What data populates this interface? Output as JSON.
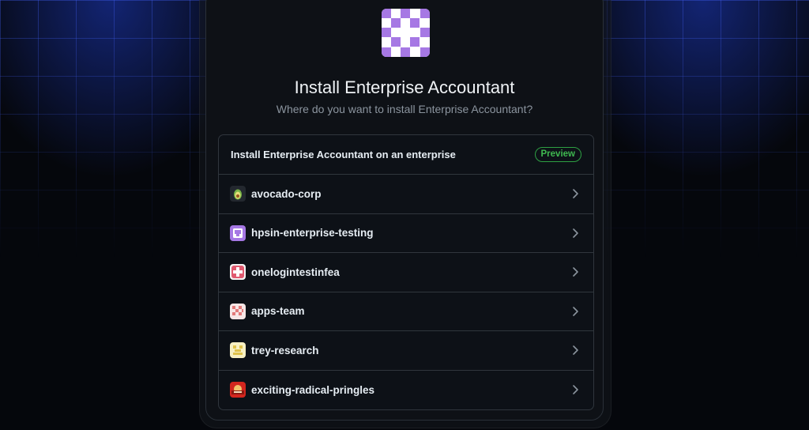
{
  "page": {
    "title": "Install Enterprise Accountant",
    "subtitle": "Where do you want to install Enterprise Accountant?"
  },
  "app_logo": {
    "icon": "app-identicon",
    "color": "#a678e4"
  },
  "panel": {
    "header": "Install Enterprise Accountant on an enterprise",
    "badge": "Preview"
  },
  "enterprises": [
    {
      "name": "avocado-corp",
      "icon": "avocado-avatar",
      "color": "#2b3a1c"
    },
    {
      "name": "hpsin-enterprise-testing",
      "icon": "purple-avatar",
      "color": "#a678e4"
    },
    {
      "name": "onelogintestinfea",
      "icon": "red-cross-avatar",
      "color": "#e05a70"
    },
    {
      "name": "apps-team",
      "icon": "checker-avatar",
      "color": "#e27a7a"
    },
    {
      "name": "trey-research",
      "icon": "yellow-avatar",
      "color": "#e8d27a"
    },
    {
      "name": "exciting-radical-pringles",
      "icon": "pringles-avatar",
      "color": "#d3261e"
    }
  ],
  "colors": {
    "background": "#05070c",
    "card": "#0e1116",
    "border": "#30363d",
    "accent_green": "#3fb950",
    "grid_blue": "#3a5cff"
  }
}
